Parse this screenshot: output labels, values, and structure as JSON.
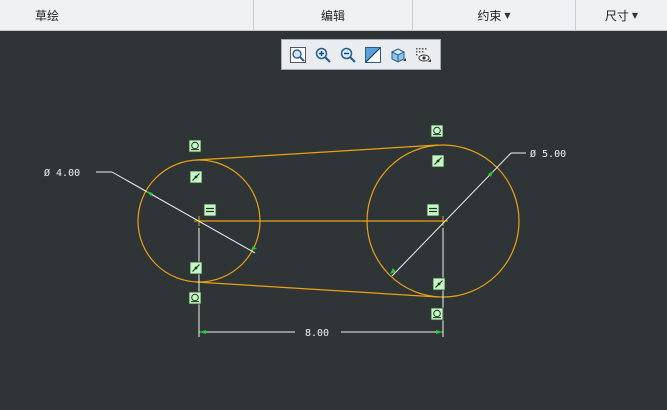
{
  "ribbon": {
    "tabs": [
      {
        "label": "草绘",
        "has_menu": false
      },
      {
        "label": "编辑",
        "has_menu": false
      },
      {
        "label": "约束",
        "has_menu": true
      },
      {
        "label": "尺寸",
        "has_menu": true
      }
    ]
  },
  "view_toolbar": {
    "buttons": [
      "refit-icon",
      "zoom-in-icon",
      "zoom-out-icon",
      "repaint-icon",
      "display-style-icon",
      "sketcher-display-icon"
    ]
  },
  "sketch": {
    "dimensions": {
      "left_diameter": "Ø 4.00",
      "right_diameter": "Ø 5.00",
      "center_distance": "8.00"
    },
    "colors": {
      "background": "#2f3436",
      "geometry": "#e8a317",
      "dimension": "#f2f2f2",
      "arrow": "#22cc33",
      "constraint_fill": "#c8f5c8"
    }
  }
}
